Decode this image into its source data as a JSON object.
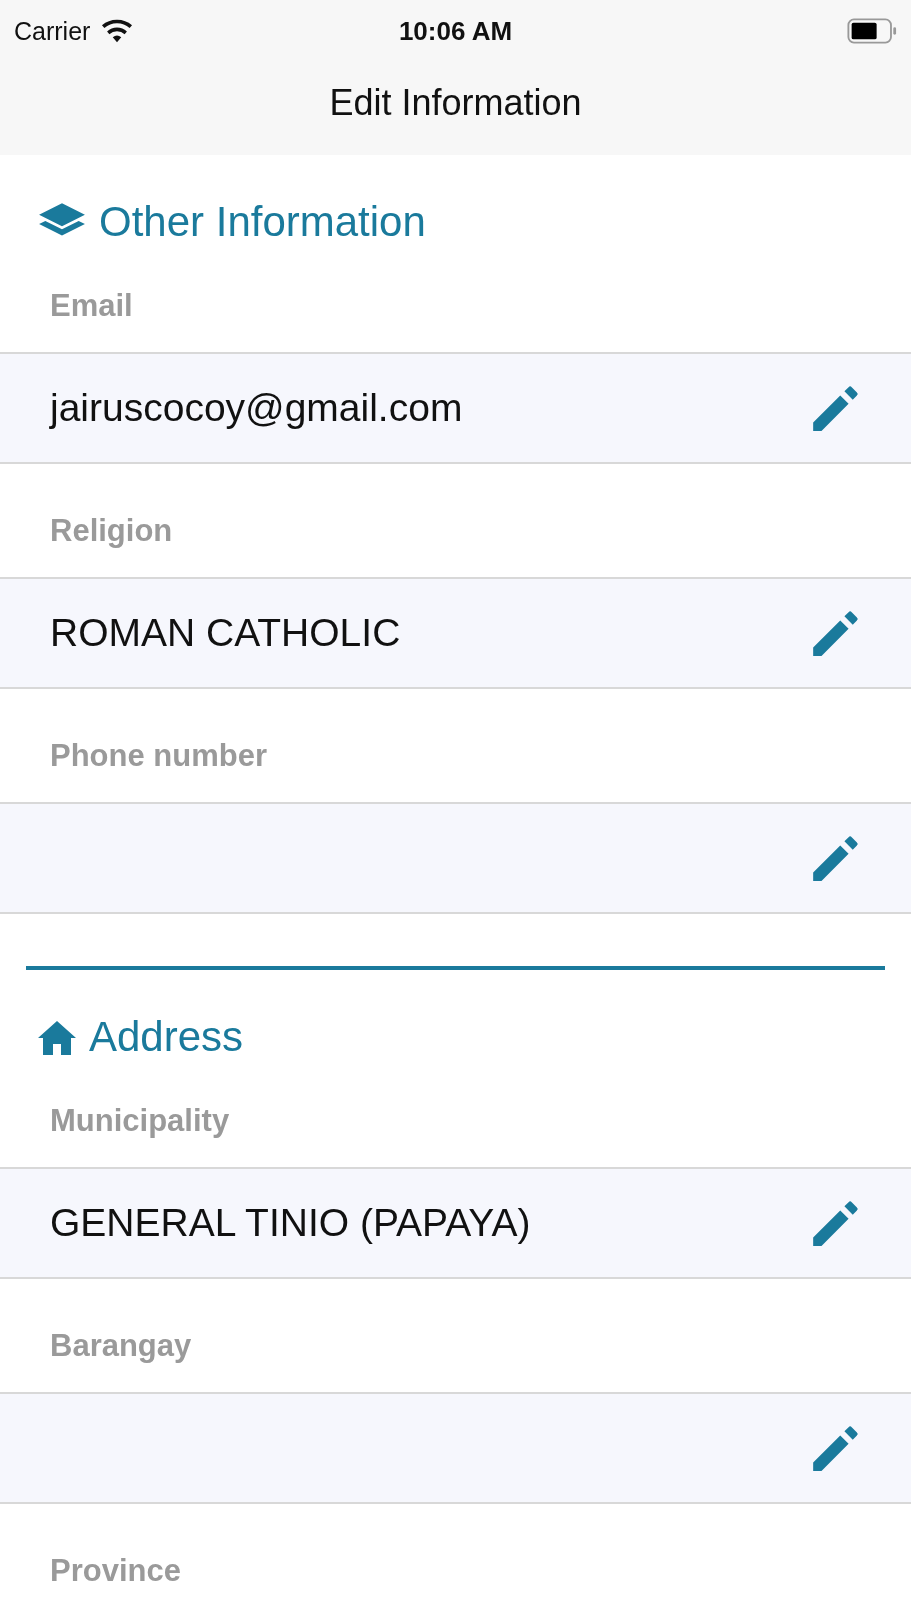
{
  "status_bar": {
    "carrier": "Carrier",
    "time": "10:06 AM"
  },
  "nav_bar": {
    "title": "Edit Information"
  },
  "sections": [
    {
      "kind": "layers",
      "title": "Other Information",
      "items": [
        {
          "kind": "field",
          "label": "Email",
          "value": "jairuscocoy@gmail.com"
        },
        {
          "kind": "field",
          "label": "Religion",
          "value": "ROMAN CATHOLIC"
        },
        {
          "kind": "field",
          "label": "Phone number"
        }
      ]
    },
    {
      "kind": "home",
      "title": "Address",
      "items": [
        {
          "kind": "field",
          "label": "Municipality",
          "value": "GENERAL TINIO (PAPAYA)"
        },
        {
          "kind": "field",
          "label": "Barangay"
        },
        {
          "kind": "label",
          "label": "Province"
        }
      ]
    }
  ]
}
